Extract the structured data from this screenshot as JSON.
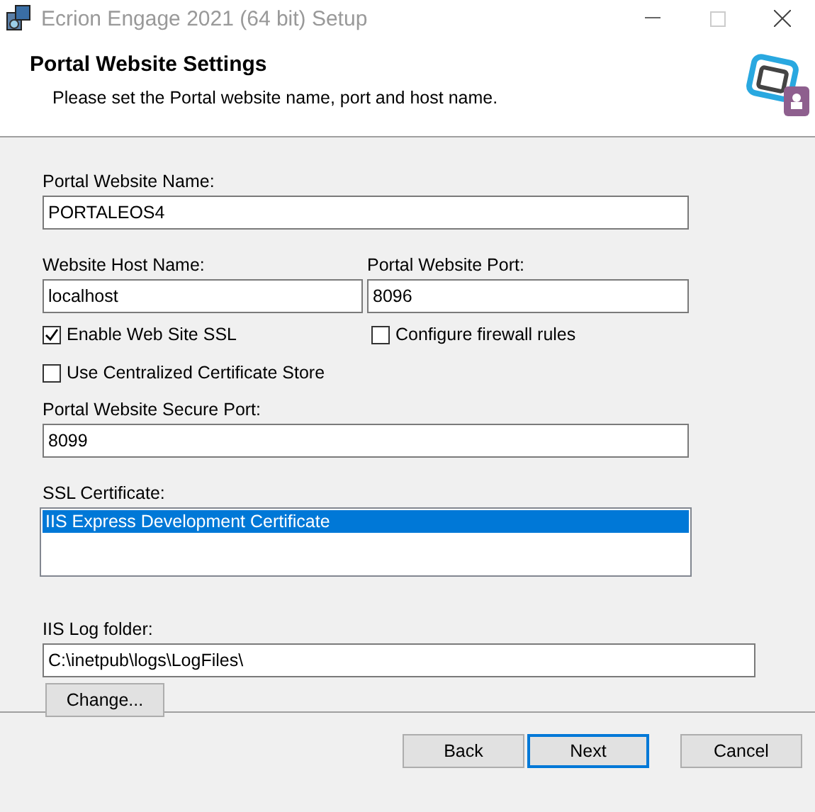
{
  "window": {
    "title": "Ecrion Engage 2021 (64 bit) Setup"
  },
  "header": {
    "title": "Portal Website Settings",
    "subtitle": "Please set the Portal website name, port and host name."
  },
  "portal_name": {
    "label": "Portal Website Name:",
    "value": "PORTALEOS4"
  },
  "host_name": {
    "label": "Website Host Name:",
    "value": "localhost"
  },
  "port": {
    "label": "Portal Website Port:",
    "value": "8096"
  },
  "enable_ssl": {
    "label": "Enable Web Site SSL",
    "checked": true
  },
  "firewall": {
    "label": "Configure firewall rules",
    "checked": false
  },
  "central_store": {
    "label": "Use Centralized Certificate Store",
    "checked": false
  },
  "secure_port": {
    "label": "Portal Website Secure Port:",
    "value": "8099"
  },
  "ssl_certificate": {
    "label": "SSL Certificate:",
    "items": [
      {
        "label": "IIS Express Development Certificate",
        "selected": true
      }
    ]
  },
  "log_folder": {
    "label": "IIS Log folder:",
    "value": "C:\\inetpub\\logs\\LogFiles\\",
    "button": "Change..."
  },
  "buttons": [
    {
      "label": "Back",
      "focused": false
    },
    {
      "label": "Next",
      "focused": true
    },
    {
      "label": "Cancel",
      "focused": false
    }
  ]
}
